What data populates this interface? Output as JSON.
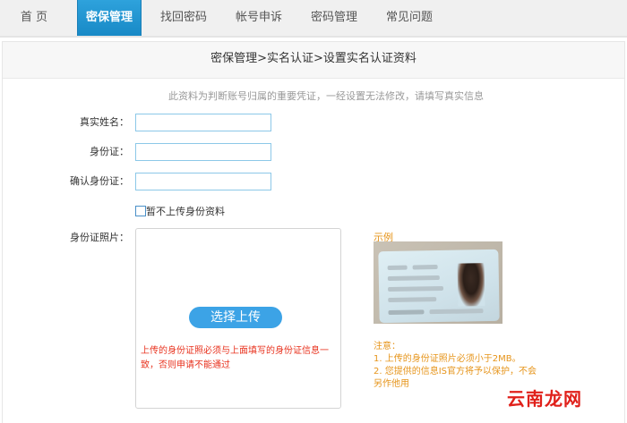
{
  "nav": {
    "items": [
      {
        "label": "首 页"
      },
      {
        "label": "密保管理"
      },
      {
        "label": "找回密码"
      },
      {
        "label": "帐号申诉"
      },
      {
        "label": "密码管理"
      },
      {
        "label": "常见问题"
      }
    ],
    "active_color": "#1a8fd2"
  },
  "panel": {
    "breadcrumb": "密保管理>实名认证>设置实名认证资料",
    "notice": "此资料为判断账号归属的重要凭证，一经设置无法修改，请填写真实信息"
  },
  "form": {
    "real_name_label": "真实姓名：",
    "real_name_value": "",
    "id_label": "身份证：",
    "id_value": "",
    "confirm_id_label": "确认身份证：",
    "confirm_id_value": "",
    "skip_upload_label": "暂不上传身份资料",
    "photo_label": "身份证照片："
  },
  "upload": {
    "button_label": "选择上传",
    "warning": "上传的身份证照必须与上面填写的身份证信息一致，否则申请不能通过"
  },
  "example": {
    "title": "示例",
    "note_title": "注意：",
    "note_1": "1. 上传的身份证照片必须小于2MB。",
    "note_2": "2. 您提供的信息IS官方将予以保护，不会另作他用"
  },
  "watermark": "云南龙网"
}
